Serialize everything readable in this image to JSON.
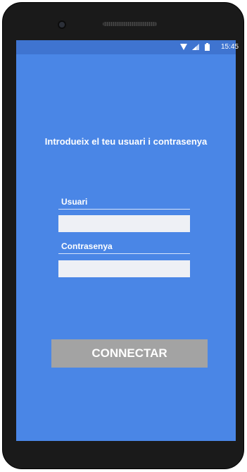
{
  "status_bar": {
    "time": "15:45",
    "icons": [
      "wifi-icon",
      "signal-icon",
      "battery-icon"
    ]
  },
  "login": {
    "title": "Introdueix el teu usuari i contrasenya",
    "username_label": "Usuari",
    "username_value": "",
    "password_label": "Contrasenya",
    "password_value": "",
    "connect_label": "CONNECTAR"
  },
  "colors": {
    "screen_background": "#4a86e6",
    "status_bar": "#3f74d0",
    "input_background": "#eef0f5",
    "button_background": "#a3a3a3",
    "text": "#ffffff"
  }
}
